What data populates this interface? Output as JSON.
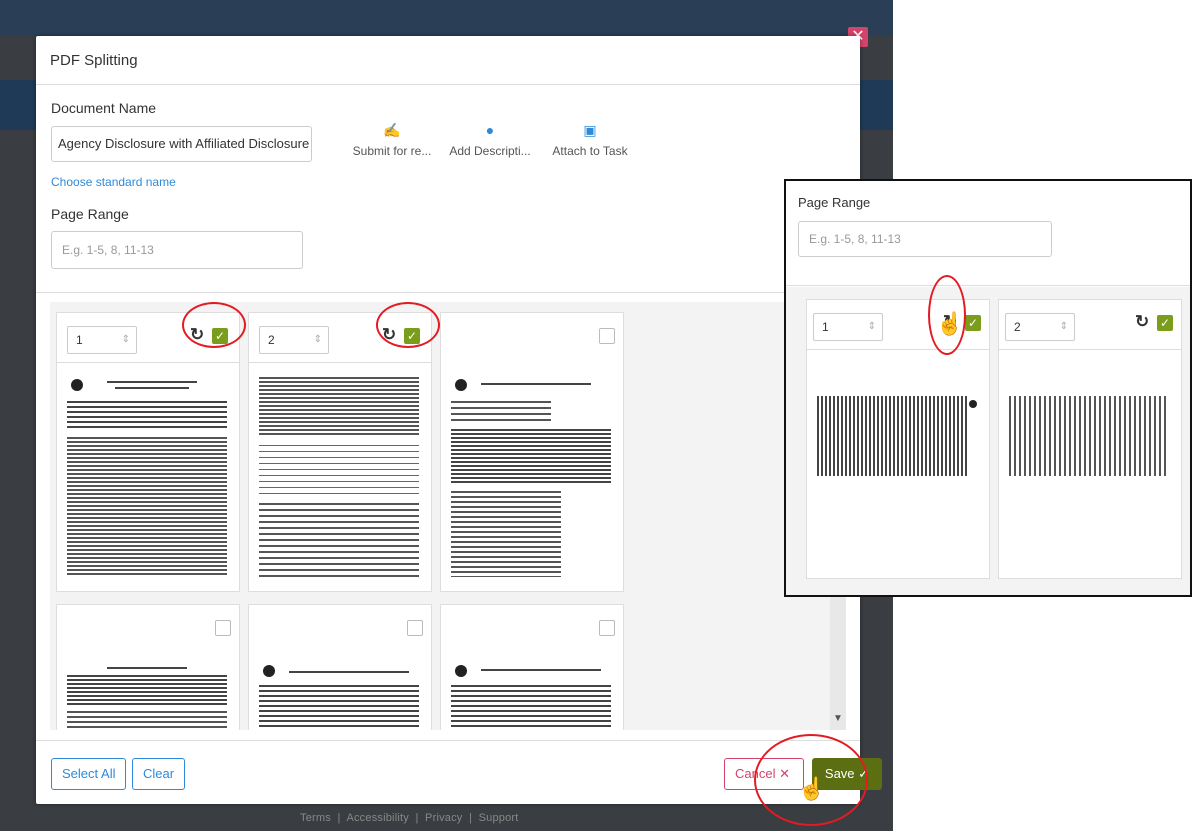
{
  "modal": {
    "title": "PDF Splitting",
    "document_name_label": "Document Name",
    "document_name_value": "Agency Disclosure with Affiliated Disclosure",
    "choose_link": "Choose standard name",
    "page_range_label": "Page Range",
    "page_range_placeholder": "E.g. 1-5, 8, 11-13"
  },
  "actions": [
    {
      "label": "Submit for re...",
      "icon": "signature-icon"
    },
    {
      "label": "Add Descripti...",
      "icon": "info-icon"
    },
    {
      "label": "Attach to Task",
      "icon": "clipboard-check-icon"
    }
  ],
  "cards": [
    {
      "number": "1",
      "selected": true
    },
    {
      "number": "2",
      "selected": true
    },
    {
      "number": "",
      "selected": false
    },
    {
      "number": "",
      "selected": false
    },
    {
      "number": "",
      "selected": false
    },
    {
      "number": "",
      "selected": false
    }
  ],
  "footer": {
    "select_all": "Select All",
    "clear": "Clear",
    "cancel": "Cancel",
    "save": "Save"
  },
  "page_footer": {
    "links": [
      "Terms",
      "Accessibility",
      "Privacy",
      "Support"
    ]
  },
  "zoom": {
    "page_range_label": "Page Range",
    "page_range_placeholder": "E.g. 1-5, 8, 11-13",
    "cards": [
      {
        "number": "1",
        "selected": true
      },
      {
        "number": "2",
        "selected": true
      }
    ]
  },
  "colors": {
    "accent": "#2e8ad8",
    "check": "#7a9e1c",
    "save": "#5c6e12",
    "cancel": "#d4436b",
    "highlight": "#e31b23"
  }
}
